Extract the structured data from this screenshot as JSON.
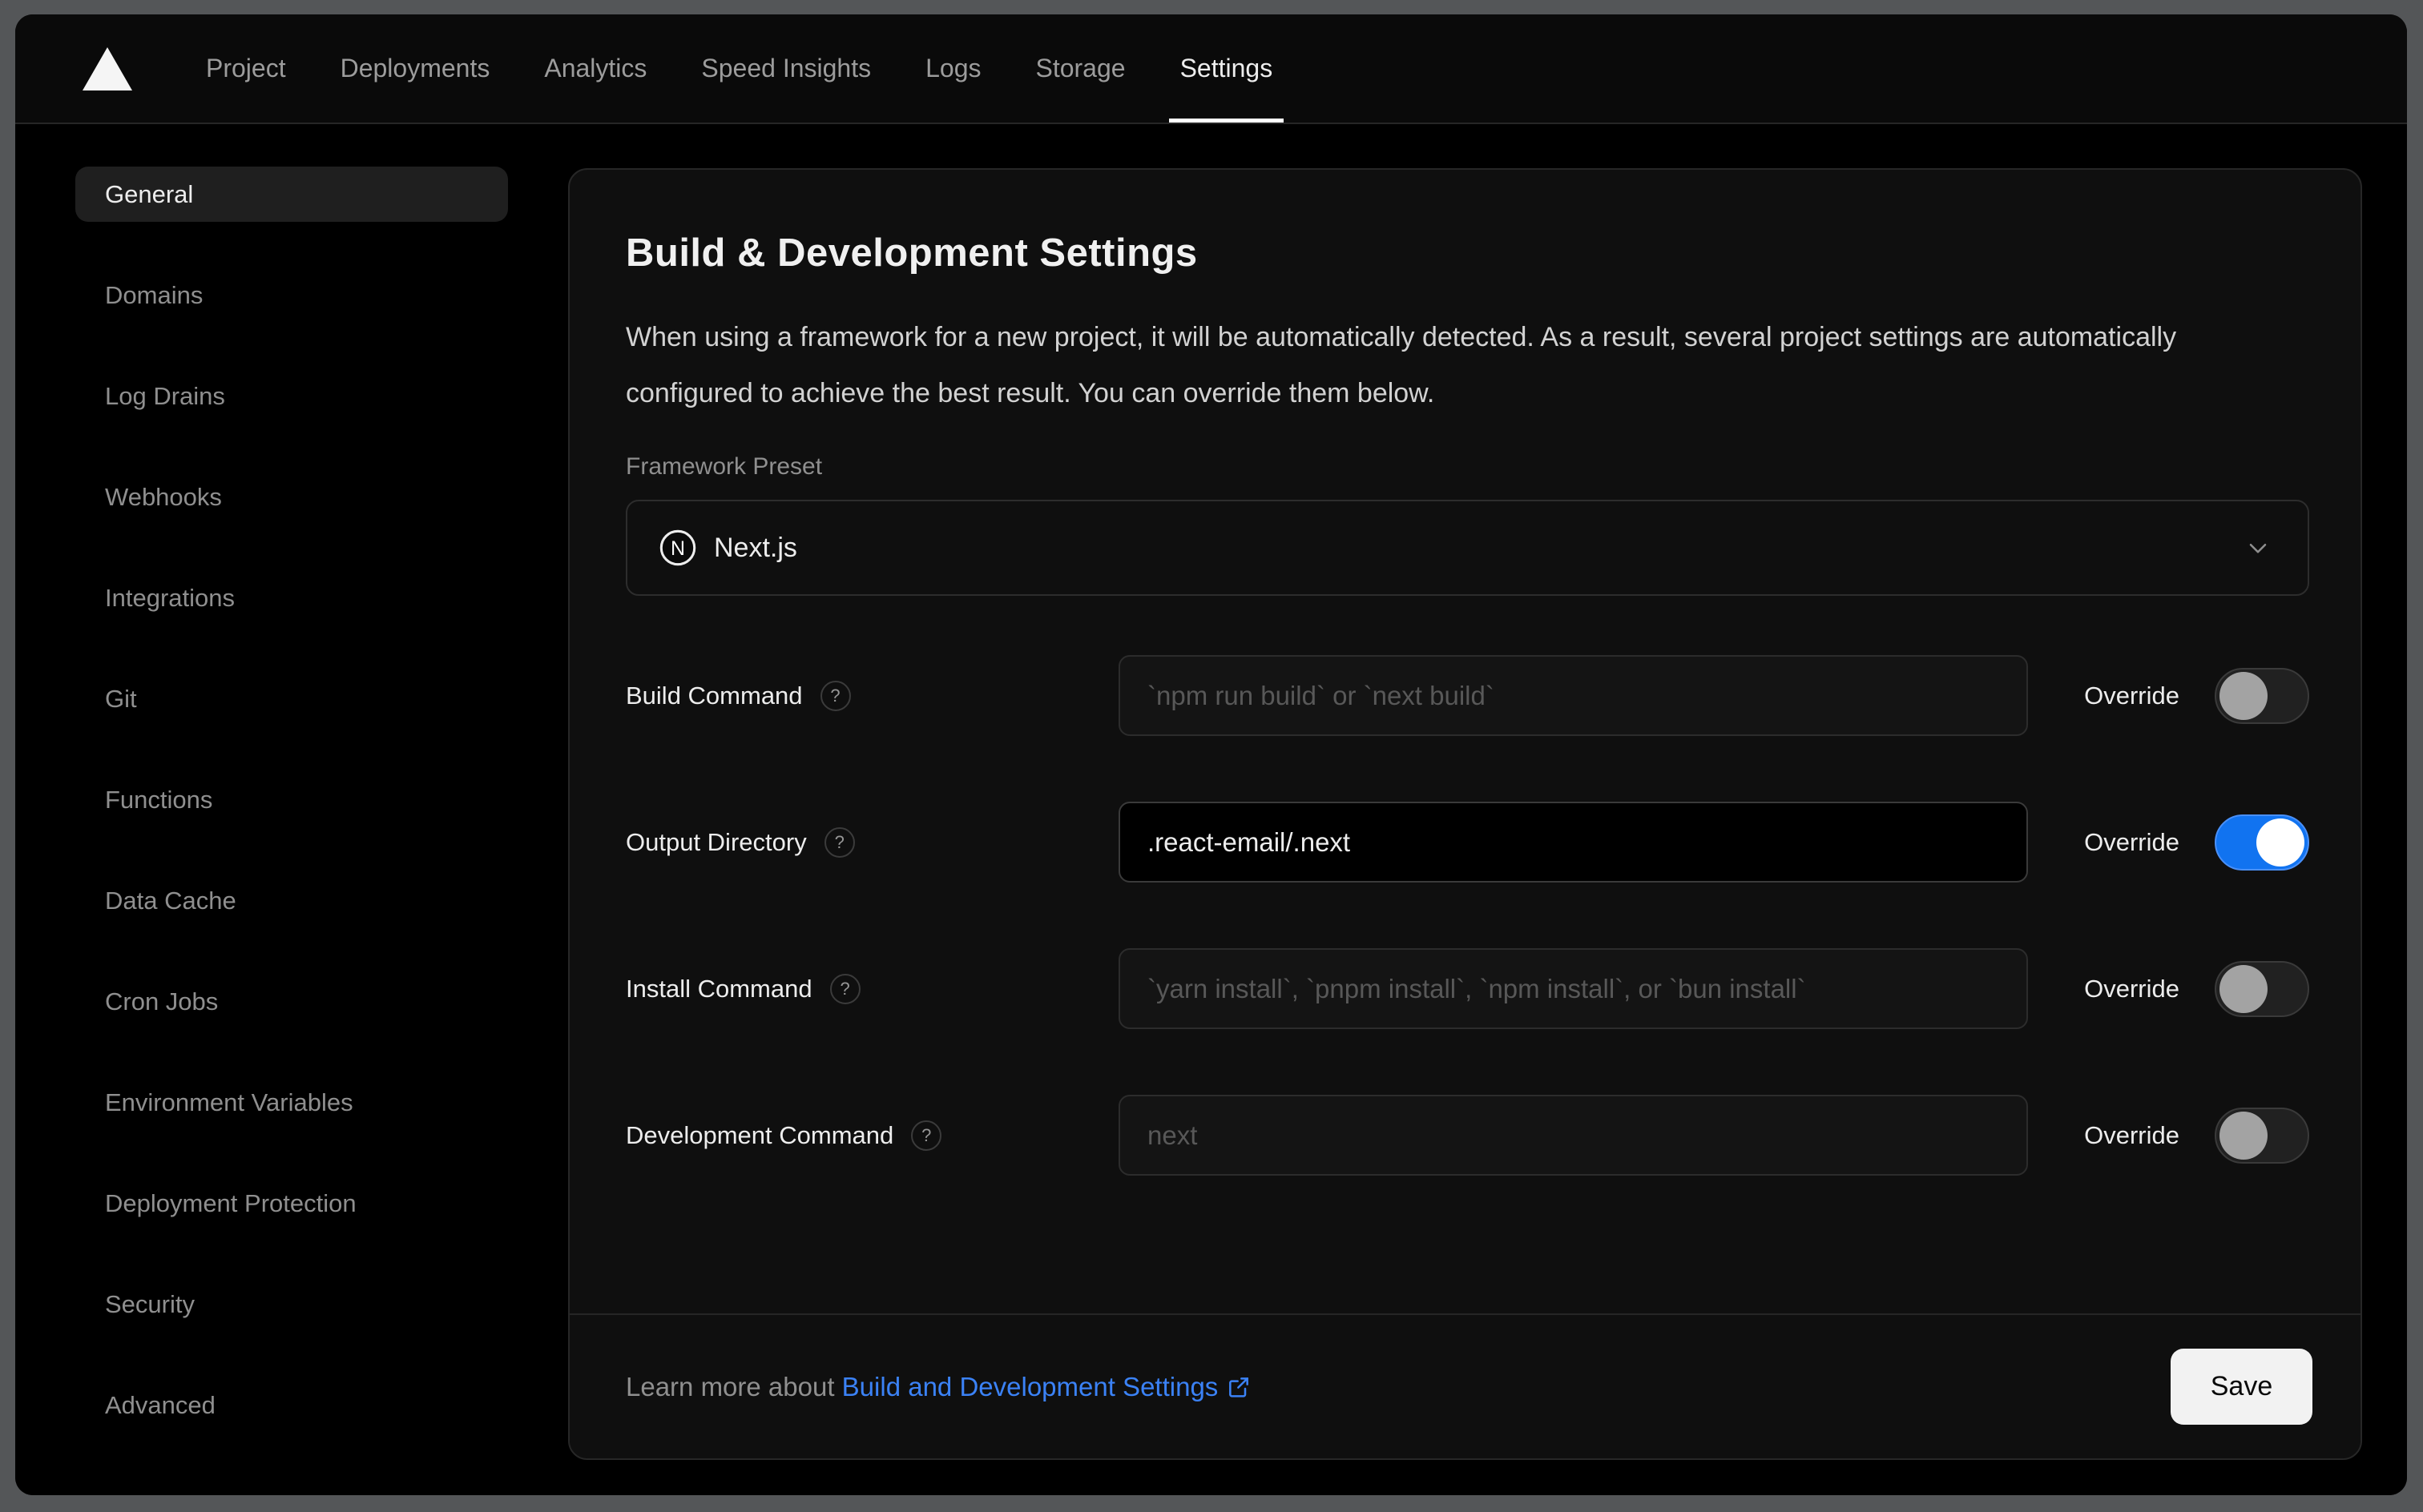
{
  "nav": {
    "logo": "vercel-triangle-logo",
    "tabs": [
      {
        "label": "Project",
        "active": false
      },
      {
        "label": "Deployments",
        "active": false
      },
      {
        "label": "Analytics",
        "active": false
      },
      {
        "label": "Speed Insights",
        "active": false
      },
      {
        "label": "Logs",
        "active": false
      },
      {
        "label": "Storage",
        "active": false
      },
      {
        "label": "Settings",
        "active": true
      }
    ]
  },
  "sidebar": {
    "items": [
      {
        "label": "General",
        "active": true
      },
      {
        "label": "Domains",
        "active": false
      },
      {
        "label": "Log Drains",
        "active": false
      },
      {
        "label": "Webhooks",
        "active": false
      },
      {
        "label": "Integrations",
        "active": false
      },
      {
        "label": "Git",
        "active": false
      },
      {
        "label": "Functions",
        "active": false
      },
      {
        "label": "Data Cache",
        "active": false
      },
      {
        "label": "Cron Jobs",
        "active": false
      },
      {
        "label": "Environment Variables",
        "active": false
      },
      {
        "label": "Deployment Protection",
        "active": false
      },
      {
        "label": "Security",
        "active": false
      },
      {
        "label": "Advanced",
        "active": false
      }
    ]
  },
  "panel": {
    "title": "Build & Development Settings",
    "description": "When using a framework for a new project, it will be automatically detected. As a result, several project settings are automatically configured to achieve the best result. You can override them below.",
    "framework": {
      "label": "Framework Preset",
      "value": "Next.js"
    },
    "override_label": "Override",
    "rows": [
      {
        "label": "Build Command",
        "placeholder": "`npm run build` or `next build`",
        "value": "",
        "override": false
      },
      {
        "label": "Output Directory",
        "placeholder": "",
        "value": ".react-email/.next",
        "override": true
      },
      {
        "label": "Install Command",
        "placeholder": "`yarn install`, `pnpm install`, `npm install`, or `bun install`",
        "value": "",
        "override": false
      },
      {
        "label": "Development Command",
        "placeholder": "next",
        "value": "",
        "override": false
      }
    ],
    "footer": {
      "learn_more_prefix": "Learn more about ",
      "link_text": "Build and Development Settings",
      "save_label": "Save"
    }
  },
  "icons": {
    "help_glyph": "?"
  },
  "colors": {
    "accent_blue_link": "#3b82f6",
    "toggle_on_blue": "#1173f0",
    "active_tab_underline": "#ffffff",
    "save_button_bg": "#f2f2f2",
    "card_bg": "#0f0f0f",
    "window_bg": "#000000",
    "frame_grey": "#545658"
  }
}
